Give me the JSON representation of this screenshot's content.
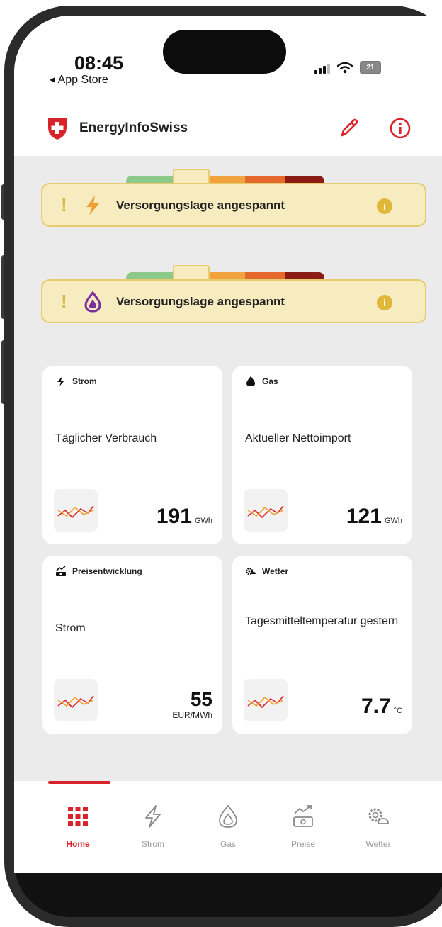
{
  "status_bar": {
    "time": "08:45",
    "back_label": "◂ App Store",
    "battery": "21"
  },
  "header": {
    "title": "EnergyInfoSwiss",
    "edit_icon": "pencil-icon",
    "info_icon": "info-circle-icon"
  },
  "alerts": [
    {
      "icon": "lightning-bolt-icon",
      "text": "Versorgungslage angespannt",
      "bang": "!",
      "info": "i"
    },
    {
      "icon": "gas-drop-icon",
      "text": "Versorgungslage angespannt",
      "bang": "!",
      "info": "i"
    }
  ],
  "cards": [
    {
      "category": "Strom",
      "icon": "lightning-bolt-icon",
      "description": "Täglicher Verbrauch",
      "value": "191",
      "unit": "GWh"
    },
    {
      "category": "Gas",
      "icon": "gas-drop-icon",
      "description": "Aktueller Nettoimport",
      "value": "121",
      "unit": "GWh"
    },
    {
      "category": "Preisentwicklung",
      "icon": "price-chart-icon",
      "description": "Strom",
      "value": "55",
      "unit": "EUR/MWh"
    },
    {
      "category": "Wetter",
      "icon": "weather-gear-icon",
      "description": "Tagesmitteltemperatur gestern",
      "value": "7.7",
      "unit": "°C"
    }
  ],
  "tabs": [
    {
      "label": "Home",
      "icon": "home-grid-icon",
      "active": true
    },
    {
      "label": "Strom",
      "icon": "lightning-bolt-icon",
      "active": false
    },
    {
      "label": "Gas",
      "icon": "gas-drop-icon",
      "active": false
    },
    {
      "label": "Preise",
      "icon": "price-chart-icon",
      "active": false
    },
    {
      "label": "Wetter",
      "icon": "weather-gear-icon",
      "active": false
    }
  ],
  "colors": {
    "accent": "#d8232a",
    "alert_bg": "#f7ecbf",
    "alert_border": "#e6cb6f",
    "gauge": [
      "#8cc98a",
      "#f0d96a",
      "#f2a23c",
      "#e5692d",
      "#8c1c13"
    ],
    "gas_purple": "#7b2d9b",
    "bolt_orange": "#f0a030"
  }
}
